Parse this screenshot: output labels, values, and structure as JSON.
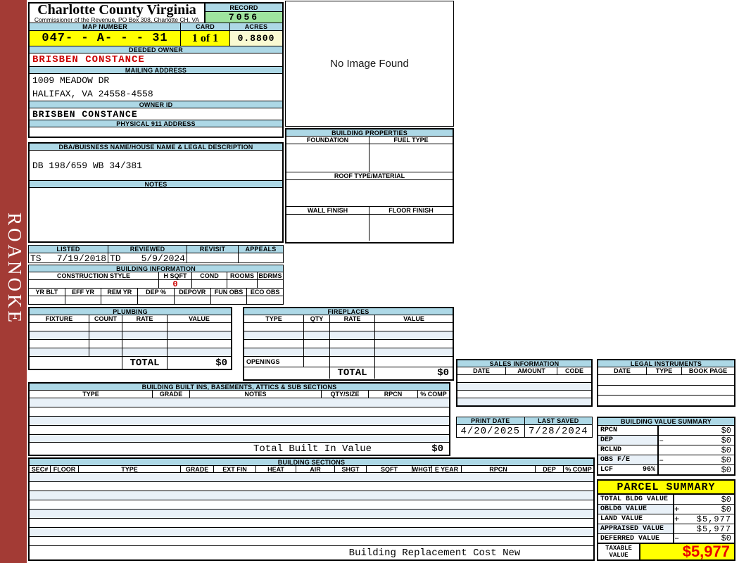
{
  "sidebar": {
    "label": "ROANOKE"
  },
  "header": {
    "county": "Charlotte County Virginia",
    "office_line": "Commissioner of the Revenue, PO Box 308, Charlotte CH, VA",
    "record_label": "RECORD",
    "record_value": "7056",
    "map_label": "MAP NUMBER",
    "map_value": "047- - A- - - 31",
    "card_label": "CARD",
    "card_value": "1 of 1",
    "acres_label": "ACRES",
    "acres_value": "0.8800"
  },
  "owner": {
    "deeded_label": "DEEDED OWNER",
    "deeded_value": "BRISBEN CONSTANCE",
    "mailing_label": "MAILING ADDRESS",
    "mailing_line1": "1009 MEADOW DR",
    "mailing_line2": "HALIFAX, VA 24558-4558",
    "owner_id_label": "OWNER ID",
    "owner_id_value": "BRISBEN CONSTANCE",
    "physical_label": "PHYSICAL 911 ADDRESS"
  },
  "legal": {
    "dba_label": "DBA/BUISNESS NAME/HOUSE NAME & LEGAL DESCRIPTION",
    "description": "DB 198/659 WB 34/381",
    "notes_label": "NOTES"
  },
  "review": {
    "listed_label": "LISTED",
    "listed_code": "TS",
    "listed_date": "7/19/2018",
    "reviewed_label": "REVIEWED",
    "reviewed_code": "TD",
    "reviewed_date": "5/9/2024",
    "revisit_label": "REVISIT",
    "appeals_label": "APPEALS"
  },
  "building_info": {
    "title": "BUILDING INFORMATION",
    "row1_headers": [
      "CONSTRUCTION STYLE",
      "H SQFT",
      "COND",
      "ROOMS",
      "BDRMS"
    ],
    "h_sqft_value": "0",
    "row2_headers": [
      "YR BLT",
      "EFF YR",
      "REM YR",
      "DEP %",
      "DEPOVR",
      "FUN OBS",
      "ECO OBS"
    ]
  },
  "plumbing": {
    "title": "PLUMBING",
    "headers": [
      "FIXTURE",
      "COUNT",
      "RATE",
      "VALUE"
    ],
    "total_label": "TOTAL",
    "total_value": "$0"
  },
  "fireplaces": {
    "title": "FIREPLACES",
    "headers": [
      "TYPE",
      "QTY",
      "RATE",
      "VALUE"
    ],
    "openings_label": "OPENINGS",
    "total_label": "TOTAL",
    "total_value": "$0"
  },
  "built_ins": {
    "title": "BUILDING BUILT INS, BASEMENTS, ATTICS & SUB SECTIONS",
    "headers": [
      "TYPE",
      "GRADE",
      "NOTES",
      "QTY/SIZE",
      "RPCN",
      "% COMP"
    ],
    "total_label": "Total Built In Value",
    "total_value": "$0"
  },
  "building_sections": {
    "title": "BUILDING SECTIONS",
    "headers": [
      "SEC#",
      "FLOOR",
      "TYPE",
      "GRADE",
      "EXT FIN",
      "HEAT",
      "AIR",
      "SHGT",
      "SQFT",
      "WHGT",
      "E YEAR",
      "RPCN",
      "DEP",
      "% COMP"
    ],
    "footer_label": "Building Replacement Cost New"
  },
  "image_panel": {
    "placeholder": "No Image Found"
  },
  "building_properties": {
    "title": "BUILDING PROPERTIES",
    "foundation_label": "FOUNDATION",
    "fuel_label": "FUEL TYPE",
    "roof_label": "ROOF TYPE/MATERIAL",
    "wall_label": "WALL FINISH",
    "floor_label": "FLOOR FINISH"
  },
  "sales": {
    "title": "SALES INFORMATION",
    "headers": [
      "DATE",
      "AMOUNT",
      "CODE"
    ]
  },
  "legal_instruments": {
    "title": "LEGAL INSTRUMENTS",
    "headers": [
      "DATE",
      "TYPE",
      "BOOK PAGE"
    ]
  },
  "print_info": {
    "print_date_label": "PRINT DATE",
    "print_date": "4/20/2025",
    "last_saved_label": "LAST SAVED",
    "last_saved": "7/28/2024"
  },
  "building_value_summary": {
    "title": "BUILDING VALUE SUMMARY",
    "rows": [
      {
        "label": "RPCN",
        "pct": "",
        "op": "",
        "value": "$0"
      },
      {
        "label": "DEP",
        "pct": "",
        "op": "–",
        "value": "$0"
      },
      {
        "label": "RCLND",
        "pct": "",
        "op": "",
        "value": "$0"
      },
      {
        "label": "OBS F/E",
        "pct": "",
        "op": "–",
        "value": "$0"
      },
      {
        "label": "LCF",
        "pct": "96%",
        "op": "",
        "value": "$0"
      }
    ]
  },
  "parcel_summary": {
    "title": "PARCEL SUMMARY",
    "rows": [
      {
        "label": "TOTAL BLDG VALUE",
        "op": "",
        "value": "$0"
      },
      {
        "label": "OBLDG VALUE",
        "op": "+",
        "value": "$0"
      },
      {
        "label": "LAND VALUE",
        "op": "+",
        "value": "$5,977"
      },
      {
        "label": "APPRAISED VALUE",
        "op": "",
        "value": "$5,977"
      },
      {
        "label": "DEFERRED VALUE",
        "op": "–",
        "value": "$0"
      }
    ],
    "taxable_label_line1": "TAXABLE",
    "taxable_label_line2": "VALUE",
    "taxable_value": "$5,977"
  },
  "colors": {
    "header_band": "#ADD8E6",
    "alt_row": "#E9F1F8",
    "record_green": "#9FE49F",
    "highlight_yellow": "#FFFF00",
    "acres_cream": "#FAFAD2",
    "owner_red": "#CC0000",
    "taxable_red": "#E80000",
    "sidebar_red": "#A33B35"
  }
}
